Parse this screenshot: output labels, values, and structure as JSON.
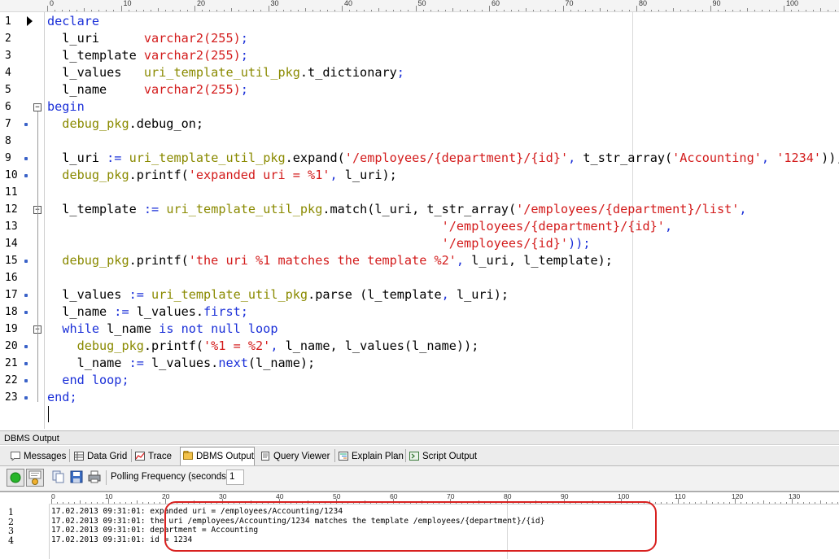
{
  "editor": {
    "ruler_numbers": [
      "0",
      "10",
      "20",
      "30",
      "40",
      "50",
      "60",
      "70",
      "80",
      "90",
      "100"
    ],
    "line_numbers": [
      "1",
      "2",
      "3",
      "4",
      "5",
      "6",
      "7",
      "8",
      "9",
      "10",
      "11",
      "12",
      "13",
      "14",
      "15",
      "16",
      "17",
      "18",
      "19",
      "20",
      "21",
      "22",
      "23"
    ],
    "lines": [
      [
        [
          "kw",
          "declare"
        ]
      ],
      [
        [
          "plain",
          "  l_uri      "
        ],
        [
          "type",
          "varchar2(255)"
        ],
        [
          "op",
          ";"
        ]
      ],
      [
        [
          "plain",
          "  l_template "
        ],
        [
          "type",
          "varchar2(255)"
        ],
        [
          "op",
          ";"
        ]
      ],
      [
        [
          "plain",
          "  l_values   "
        ],
        [
          "pkg",
          "uri_template_util_pkg"
        ],
        [
          "plain",
          ".t_dictionary"
        ],
        [
          "op",
          ";"
        ]
      ],
      [
        [
          "plain",
          "  l_name     "
        ],
        [
          "type",
          "varchar2(255)"
        ],
        [
          "op",
          ";"
        ]
      ],
      [
        [
          "kw",
          "begin"
        ]
      ],
      [
        [
          "plain",
          "  "
        ],
        [
          "pkg",
          "debug_pkg"
        ],
        [
          "plain",
          ".debug_on;"
        ]
      ],
      [
        [
          "plain",
          ""
        ]
      ],
      [
        [
          "plain",
          "  l_uri "
        ],
        [
          "op",
          ":="
        ],
        [
          "plain",
          " "
        ],
        [
          "pkg",
          "uri_template_util_pkg"
        ],
        [
          "plain",
          ".expand("
        ],
        [
          "str",
          "'/employees/{department}/{id}'"
        ],
        [
          "op",
          ","
        ],
        [
          "plain",
          " t_str_array("
        ],
        [
          "str",
          "'Accounting'"
        ],
        [
          "op",
          ","
        ],
        [
          "plain",
          " "
        ],
        [
          "str",
          "'1234'"
        ],
        [
          "plain",
          "));"
        ]
      ],
      [
        [
          "plain",
          "  "
        ],
        [
          "pkg",
          "debug_pkg"
        ],
        [
          "plain",
          ".printf("
        ],
        [
          "str",
          "'expanded uri = %1'"
        ],
        [
          "op",
          ","
        ],
        [
          "plain",
          " l_uri);"
        ]
      ],
      [
        [
          "plain",
          ""
        ]
      ],
      [
        [
          "plain",
          "  l_template "
        ],
        [
          "op",
          ":="
        ],
        [
          "plain",
          " "
        ],
        [
          "pkg",
          "uri_template_util_pkg"
        ],
        [
          "plain",
          ".match(l_uri, t_str_array("
        ],
        [
          "str",
          "'/employees/{department}/list'"
        ],
        [
          "op",
          ","
        ]
      ],
      [
        [
          "plain",
          "                                                     "
        ],
        [
          "str",
          "'/employees/{department}/{id}'"
        ],
        [
          "op",
          ","
        ]
      ],
      [
        [
          "plain",
          "                                                     "
        ],
        [
          "str",
          "'/employees/{id}'"
        ],
        [
          "op",
          "));"
        ]
      ],
      [
        [
          "plain",
          "  "
        ],
        [
          "pkg",
          "debug_pkg"
        ],
        [
          "plain",
          ".printf("
        ],
        [
          "str",
          "'the uri %1 matches the template %2'"
        ],
        [
          "op",
          ","
        ],
        [
          "plain",
          " l_uri, l_template);"
        ]
      ],
      [
        [
          "plain",
          ""
        ]
      ],
      [
        [
          "plain",
          "  l_values "
        ],
        [
          "op",
          ":="
        ],
        [
          "plain",
          " "
        ],
        [
          "pkg",
          "uri_template_util_pkg"
        ],
        [
          "plain",
          ".parse (l_template"
        ],
        [
          "op",
          ","
        ],
        [
          "plain",
          " l_uri);"
        ]
      ],
      [
        [
          "plain",
          "  l_name "
        ],
        [
          "op",
          ":="
        ],
        [
          "plain",
          " l_values."
        ],
        [
          "kw",
          "first"
        ],
        [
          "op",
          ";"
        ]
      ],
      [
        [
          "plain",
          "  "
        ],
        [
          "kw",
          "while"
        ],
        [
          "plain",
          " l_name "
        ],
        [
          "kw",
          "is not null loop"
        ]
      ],
      [
        [
          "plain",
          "    "
        ],
        [
          "pkg",
          "debug_pkg"
        ],
        [
          "plain",
          ".printf("
        ],
        [
          "str",
          "'%1 = %2'"
        ],
        [
          "op",
          ","
        ],
        [
          "plain",
          " l_name, l_values(l_name));"
        ]
      ],
      [
        [
          "plain",
          "    l_name "
        ],
        [
          "op",
          ":="
        ],
        [
          "plain",
          " l_values."
        ],
        [
          "kw",
          "next"
        ],
        [
          "plain",
          "(l_name);"
        ]
      ],
      [
        [
          "plain",
          "  "
        ],
        [
          "kw",
          "end loop"
        ],
        [
          "op",
          ";"
        ]
      ],
      [
        [
          "kw",
          "end"
        ],
        [
          "op",
          ";"
        ]
      ]
    ]
  },
  "panel": {
    "title": "DBMS Output",
    "tabs": [
      "Messages",
      "Data Grid",
      "Trace",
      "DBMS Output",
      "Query Viewer",
      "Explain Plan",
      "Script Output"
    ],
    "active_tab": "DBMS Output",
    "toolbar": {
      "poll_label": "Polling Frequency (seconds):",
      "poll_value": "1"
    },
    "ruler_numbers": [
      "0",
      "10",
      "20",
      "30",
      "40",
      "50",
      "60",
      "70",
      "80",
      "90",
      "100",
      "110",
      "120",
      "130"
    ],
    "output_line_numbers": [
      "1",
      "2",
      "3",
      "4"
    ],
    "output_lines": [
      "17.02.2013 09:31:01: expanded uri = /employees/Accounting/1234",
      "17.02.2013 09:31:01: the uri /employees/Accounting/1234 matches the template /employees/{department}/{id}",
      "17.02.2013 09:31:01: department = Accounting",
      "17.02.2013 09:31:01: id = 1234"
    ]
  },
  "colors": {
    "keyword": "#1a2fd8",
    "string": "#d31b1b",
    "package": "#8a8a00",
    "highlight_oval": "#d8201f"
  }
}
